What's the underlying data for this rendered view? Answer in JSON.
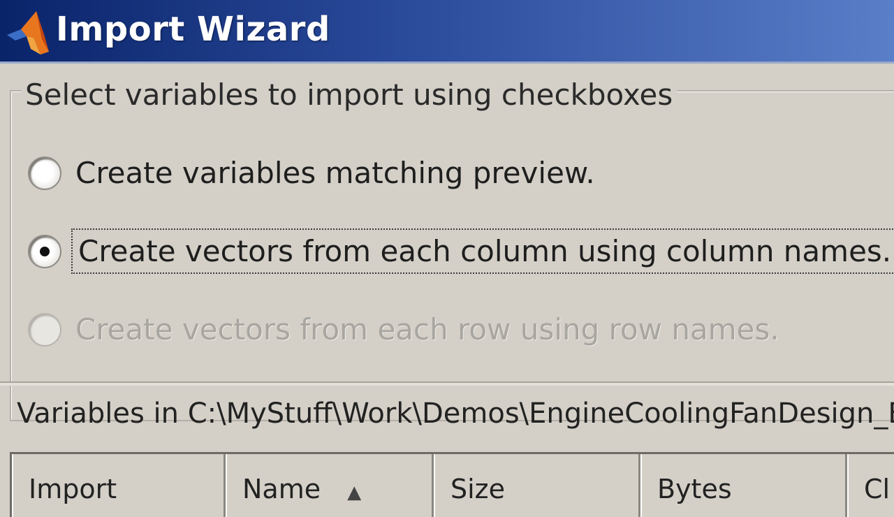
{
  "window": {
    "title": "Import Wizard",
    "icon": "matlab-logo-icon"
  },
  "options": {
    "legend": "Select variables to import using checkboxes",
    "radios": [
      {
        "label": "Create variables matching preview.",
        "checked": false,
        "enabled": true
      },
      {
        "label": "Create vectors from each column using column names.",
        "checked": true,
        "enabled": true
      },
      {
        "label": "Create vectors from each row using row names.",
        "checked": false,
        "enabled": false
      }
    ]
  },
  "variables": {
    "label": "Variables in C:\\MyStuff\\Work\\Demos\\EngineCoolingFanDesign_En",
    "columns": [
      "Import",
      "Name",
      "Size",
      "Bytes",
      "Cl"
    ],
    "sort_column": "Name",
    "sort_icon": "sort-ascending-icon"
  }
}
